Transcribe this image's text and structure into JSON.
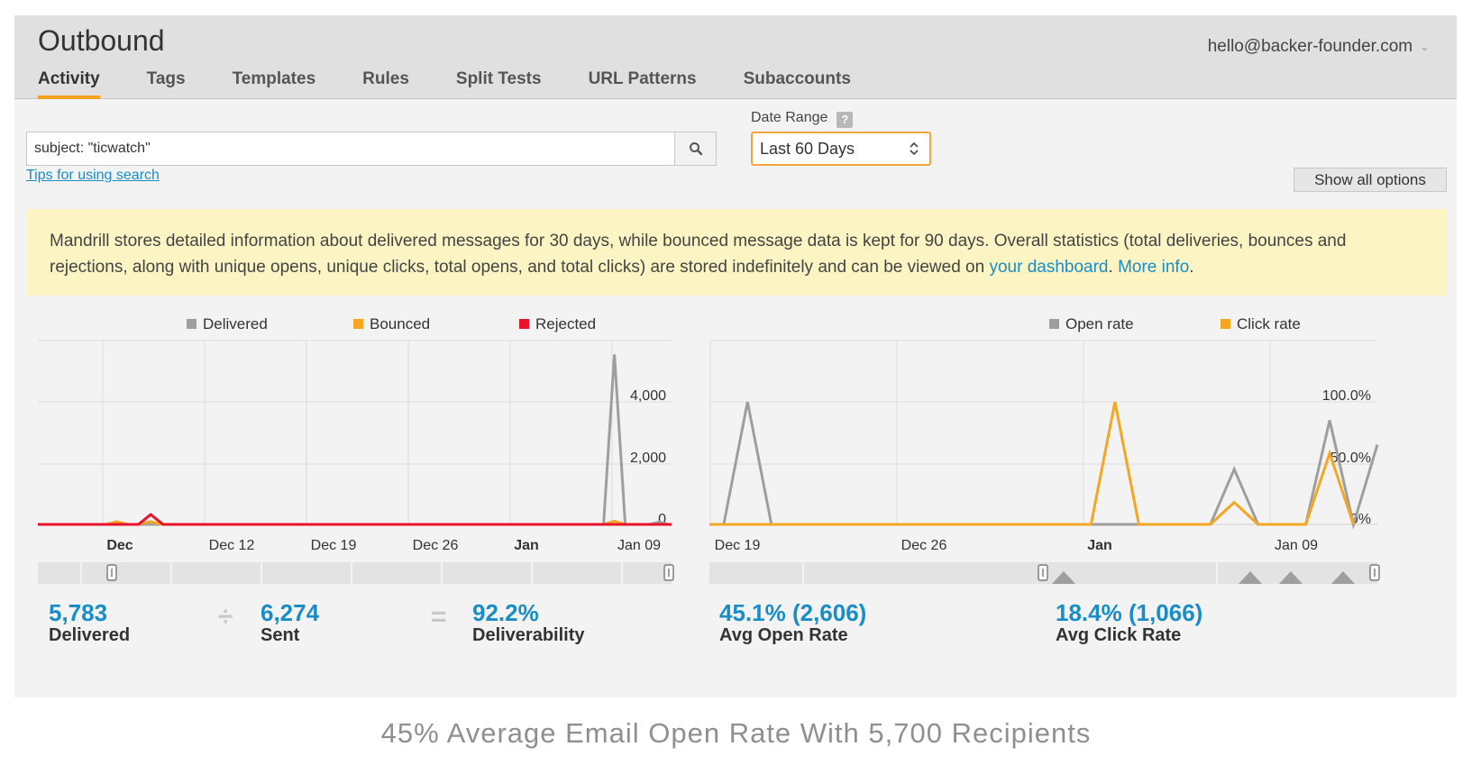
{
  "header": {
    "title": "Outbound",
    "account": "hello@backer-founder.com",
    "tabs": [
      {
        "label": "Activity",
        "active": true
      },
      {
        "label": "Tags"
      },
      {
        "label": "Templates"
      },
      {
        "label": "Rules"
      },
      {
        "label": "Split Tests"
      },
      {
        "label": "URL Patterns"
      },
      {
        "label": "Subaccounts"
      }
    ]
  },
  "search": {
    "value": "subject: \"ticwatch\"",
    "tips_link": "Tips for using search",
    "icon": "search-icon"
  },
  "date_range": {
    "label": "Date Range",
    "help": "?",
    "selected": "Last 60 Days"
  },
  "show_all_options": "Show all options",
  "notice": {
    "text": "Mandrill stores detailed information about delivered messages for 30 days, while bounced message data is kept for 90 days. Overall statistics (total deliveries, bounces and rejections, along with unique opens, unique clicks, total opens, and total clicks) are stored indefinitely and can be viewed on ",
    "link1": "your dashboard",
    "sep": ". ",
    "link2": "More info",
    "end": "."
  },
  "colors": {
    "accent": "#f39f1a",
    "link": "#1a8dc7",
    "delivered": "#9e9e9e",
    "bounced": "#f5a623",
    "rejected": "#e8132b",
    "open_rate": "#9e9e9e",
    "click_rate": "#f5a623"
  },
  "chart_data": [
    {
      "type": "line",
      "legend": [
        "Delivered",
        "Bounced",
        "Rejected"
      ],
      "x_ticks": [
        "Dec",
        "Dec 12",
        "Dec 19",
        "Dec 26",
        "Jan",
        "Jan 09"
      ],
      "y_ticks": [
        "4,000",
        "2,000",
        "0"
      ],
      "ylim": [
        0,
        6000
      ],
      "series": [
        {
          "name": "Delivered",
          "color": "#9e9e9e",
          "points": [
            [
              5,
              0
            ],
            [
              6.2,
              0
            ],
            [
              7.3,
              0
            ],
            [
              8,
              0
            ],
            [
              9,
              0
            ],
            [
              10,
              0
            ],
            [
              11,
              0
            ],
            [
              12,
              0
            ],
            [
              13,
              0
            ],
            [
              14,
              0
            ],
            [
              15,
              0
            ],
            [
              16,
              0
            ],
            [
              17,
              0
            ],
            [
              18,
              0
            ],
            [
              19,
              0
            ],
            [
              20,
              0
            ],
            [
              21,
              0
            ],
            [
              22,
              0
            ],
            [
              23,
              0
            ],
            [
              24,
              0
            ],
            [
              25,
              0
            ],
            [
              26,
              0
            ],
            [
              27,
              0
            ],
            [
              28,
              0
            ],
            [
              29,
              0
            ],
            [
              30,
              0
            ],
            [
              31,
              0
            ],
            [
              32,
              0
            ],
            [
              33,
              0
            ],
            [
              34,
              0
            ],
            [
              35,
              0
            ],
            [
              36,
              0
            ],
            [
              36.6,
              0
            ],
            [
              37.3,
              5550
            ],
            [
              38,
              0
            ],
            [
              39,
              0
            ],
            [
              39.6,
              0
            ],
            [
              40.2,
              80
            ],
            [
              40.8,
              0
            ],
            [
              41,
              0
            ]
          ]
        },
        {
          "name": "Bounced",
          "color": "#f5a623",
          "points": [
            [
              0,
              0
            ],
            [
              4.4,
              0
            ],
            [
              5.1,
              90
            ],
            [
              5.8,
              0
            ],
            [
              6.4,
              0
            ],
            [
              7.3,
              90
            ],
            [
              8,
              0
            ],
            [
              9,
              0
            ],
            [
              36.6,
              0
            ],
            [
              37.3,
              110
            ],
            [
              38,
              0
            ],
            [
              41,
              0
            ]
          ]
        },
        {
          "name": "Rejected",
          "color": "#e8132b",
          "points": [
            [
              0,
              0
            ],
            [
              6.5,
              0
            ],
            [
              7.3,
              320
            ],
            [
              8.1,
              0
            ],
            [
              41,
              0
            ]
          ]
        }
      ]
    },
    {
      "type": "line",
      "legend": [
        "Open rate",
        "Click rate"
      ],
      "x_ticks": [
        "Dec 19",
        "Dec 26",
        "Jan",
        "Jan 09"
      ],
      "y_ticks": [
        "100.0%",
        "50.0%",
        "0%"
      ],
      "ylim": [
        0,
        150
      ],
      "series": [
        {
          "name": "Open rate",
          "color": "#9e9e9e",
          "points": [
            [
              0,
              0
            ],
            [
              0.6,
              0
            ],
            [
              1.6,
              100
            ],
            [
              2.6,
              0
            ],
            [
              17,
              0
            ],
            [
              18,
              0
            ],
            [
              19,
              0
            ],
            [
              20,
              0
            ],
            [
              21,
              0
            ],
            [
              22,
              45
            ],
            [
              23,
              0
            ],
            [
              25,
              0
            ],
            [
              26,
              85
            ],
            [
              27,
              0
            ],
            [
              28,
              65
            ]
          ]
        },
        {
          "name": "Click rate",
          "color": "#f5a623",
          "points": [
            [
              0,
              0
            ],
            [
              15,
              0
            ],
            [
              16,
              0
            ],
            [
              17,
              100
            ],
            [
              18,
              0
            ],
            [
              19,
              0
            ],
            [
              21,
              0
            ],
            [
              22,
              18
            ],
            [
              23,
              0
            ],
            [
              25,
              0
            ],
            [
              26,
              58
            ],
            [
              27,
              0
            ]
          ]
        }
      ]
    }
  ],
  "stats": {
    "delivered": {
      "value": "5,783",
      "label": "Delivered"
    },
    "op_divide": "÷",
    "sent": {
      "value": "6,274",
      "label": "Sent"
    },
    "op_equals": "=",
    "deliverability": {
      "value": "92.2%",
      "label": "Deliverability"
    },
    "open_rate": {
      "value": "45.1% (2,606)",
      "label": "Avg Open Rate"
    },
    "click_rate": {
      "value": "18.4% (1,066)",
      "label": "Avg Click Rate"
    }
  },
  "caption": "45% Average Email Open Rate With 5,700 Recipients"
}
